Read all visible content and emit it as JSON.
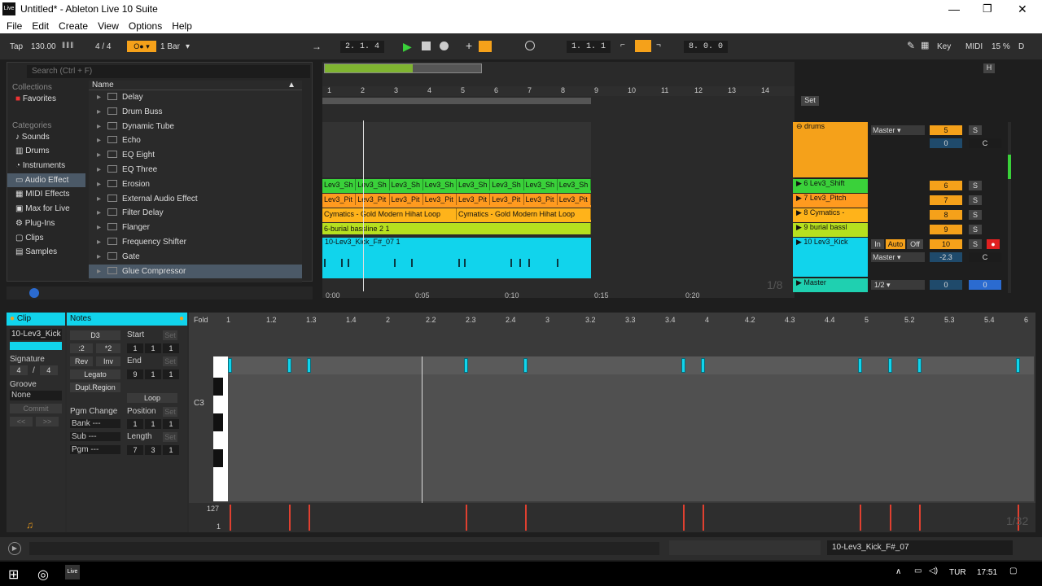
{
  "window": {
    "title": "Untitled* - Ableton Live 10 Suite",
    "app_icon": "Live"
  },
  "menu": [
    "File",
    "Edit",
    "Create",
    "View",
    "Options",
    "Help"
  ],
  "transport": {
    "tap": "Tap",
    "tempo": "130.00",
    "time_sig": "4 / 4",
    "quantize": "1 Bar",
    "arr_position": "2. 1. 4",
    "loop_start": "1. 1. 1",
    "loop_length": "8. 0. 0",
    "key_label": "Key",
    "midi_label": "MIDI",
    "cpu": "15 %",
    "disk": "D"
  },
  "browser": {
    "search_placeholder": "Search (Ctrl + F)",
    "collections_label": "Collections",
    "favorites": "Favorites",
    "categories_label": "Categories",
    "categories": [
      "Sounds",
      "Drums",
      "Instruments",
      "Audio Effect",
      "MIDI Effects",
      "Max for Live",
      "Plug-Ins",
      "Clips",
      "Samples"
    ],
    "name_header": "Name",
    "items": [
      "Delay",
      "Drum Buss",
      "Dynamic Tube",
      "Echo",
      "EQ Eight",
      "EQ Three",
      "Erosion",
      "External Audio Effect",
      "Filter Delay",
      "Flanger",
      "Frequency Shifter",
      "Gate",
      "Glue Compressor"
    ]
  },
  "arrangement": {
    "bars": [
      "1",
      "2",
      "3",
      "4",
      "5",
      "6",
      "7",
      "8",
      "9",
      "10",
      "11",
      "12",
      "13",
      "14"
    ],
    "set_label": "Set",
    "times": [
      "0:00",
      "0:05",
      "0:10",
      "0:15",
      "0:20"
    ],
    "zoom": "1/8",
    "shift_label": "Lev3_Sh",
    "pitch_label": "Lev3_Pit",
    "cymatics_label": "Cymatics - Gold Modern Hihat Loop",
    "bassline_label": "6-burial bassline 2 1",
    "kick_label": "10-Lev3_Kick_F#_07 1"
  },
  "mixer": {
    "tracks": [
      {
        "name": "drums",
        "routing": "Master",
        "num": "5",
        "s": "S",
        "vol": "0",
        "pan": "C",
        "color": "#f5a11a"
      },
      {
        "name": "6 Lev3_Shift",
        "num": "6",
        "s": "S",
        "color": "#3ad13a"
      },
      {
        "name": "7 Lev3_Pitch",
        "num": "7",
        "s": "S",
        "color": "#ff9a1f"
      },
      {
        "name": "8 Cymatics -",
        "num": "8",
        "s": "S",
        "color": "#ffb31a"
      },
      {
        "name": "9 burial bassl",
        "num": "9",
        "s": "S",
        "color": "#b6e01f"
      },
      {
        "name": "10 Lev3_Kick",
        "in": "In",
        "auto": "Auto",
        "off": "Off",
        "routing": "Master",
        "num": "10",
        "s": "S",
        "vol": "-2.3",
        "pan": "C",
        "color": "#11d4ec"
      }
    ],
    "master": {
      "name": "Master",
      "ratio": "1/2",
      "vol": "0",
      "pan": "0"
    }
  },
  "clip_panel": {
    "clip_label": "Clip",
    "clip_name": "10-Lev3_Kick",
    "signature_label": "Signature",
    "sig_num": "4",
    "sig_den": "4",
    "groove_label": "Groove",
    "groove_value": "None",
    "commit": "Commit"
  },
  "notes_panel": {
    "notes_label": "Notes",
    "note": "D3",
    "div2": ":2",
    "mul2": "*2",
    "rev": "Rev",
    "inv": "Inv",
    "legato": "Legato",
    "dupl": "Dupl.Region",
    "pgm_change": "Pgm Change",
    "bank": "Bank ---",
    "sub": "Sub ---",
    "pgm": "Pgm ---",
    "start_label": "Start",
    "set": "Set",
    "start": [
      "1",
      "1",
      "1"
    ],
    "end_label": "End",
    "end": [
      "9",
      "1",
      "1"
    ],
    "loop": "Loop",
    "position_label": "Position",
    "position": [
      "1",
      "1",
      "1"
    ],
    "length_label": "Length",
    "length": [
      "7",
      "3",
      "1"
    ]
  },
  "piano_roll": {
    "fold": "Fold",
    "ruler": [
      "1",
      "1.2",
      "1.3",
      "1.4",
      "2",
      "2.2",
      "2.3",
      "2.4",
      "3",
      "3.2",
      "3.3",
      "3.4",
      "4",
      "4.2",
      "4.3",
      "4.4",
      "5",
      "5.2",
      "5.3",
      "5.4",
      "6"
    ],
    "key_label": "C3",
    "vel_max": "127",
    "vel_min": "1",
    "grid": "1/32",
    "note_beats": [
      0.0,
      0.75,
      1.0,
      3.0,
      3.75,
      5.75,
      6.0,
      8.0,
      8.375,
      8.75,
      10.0
    ],
    "total_beats": 10.125
  },
  "status": {
    "clip_info": "10-Lev3_Kick_F#_07"
  },
  "taskbar": {
    "lang": "TUR",
    "time": "17:51"
  }
}
